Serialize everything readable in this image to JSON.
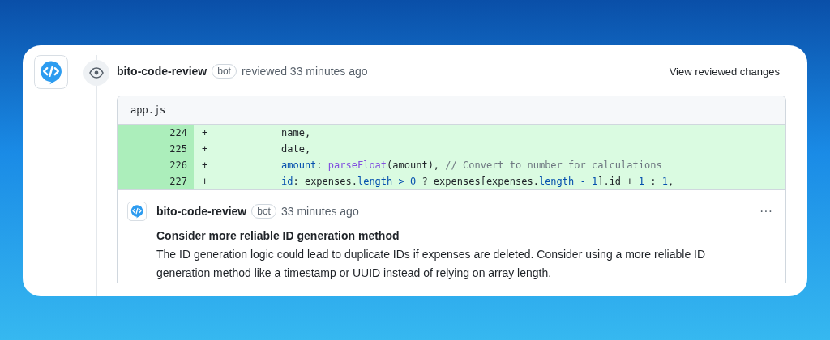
{
  "review": {
    "author": "bito-code-review",
    "badge": "bot",
    "action": "reviewed 33 minutes ago",
    "view_button": "View reviewed changes"
  },
  "diff": {
    "file": "app.js",
    "lines": [
      {
        "number": "224",
        "sign": "+",
        "tokens": [
          {
            "text": "name,",
            "kind": "plain"
          }
        ]
      },
      {
        "number": "225",
        "sign": "+",
        "tokens": [
          {
            "text": "date,",
            "kind": "plain"
          }
        ]
      },
      {
        "number": "226",
        "sign": "+",
        "tokens": [
          {
            "text": "amount",
            "kind": "keyword"
          },
          {
            "text": ": ",
            "kind": "plain"
          },
          {
            "text": "parseFloat",
            "kind": "function"
          },
          {
            "text": "(amount), ",
            "kind": "plain"
          },
          {
            "text": "// Convert to number for calculations",
            "kind": "comment"
          }
        ]
      },
      {
        "number": "227",
        "sign": "+",
        "tokens": [
          {
            "text": "id",
            "kind": "keyword"
          },
          {
            "text": ": expenses.",
            "kind": "plain"
          },
          {
            "text": "length",
            "kind": "keyword"
          },
          {
            "text": " > 0 ",
            "kind": "keyword"
          },
          {
            "text": "? expenses[expenses.",
            "kind": "plain"
          },
          {
            "text": "length",
            "kind": "keyword"
          },
          {
            "text": " - 1",
            "kind": "keyword"
          },
          {
            "text": "].id + ",
            "kind": "plain"
          },
          {
            "text": "1",
            "kind": "keyword"
          },
          {
            "text": " : ",
            "kind": "plain"
          },
          {
            "text": "1",
            "kind": "keyword"
          },
          {
            "text": ",",
            "kind": "plain"
          }
        ]
      }
    ]
  },
  "comment": {
    "author": "bito-code-review",
    "badge": "bot",
    "time": "33 minutes ago",
    "menu": "···",
    "title": "Consider more reliable ID generation method",
    "body": "The ID generation logic could lead to duplicate IDs if expenses are deleted. Consider using a more reliable ID generation method like a timestamp or UUID instead of relying on array length."
  }
}
